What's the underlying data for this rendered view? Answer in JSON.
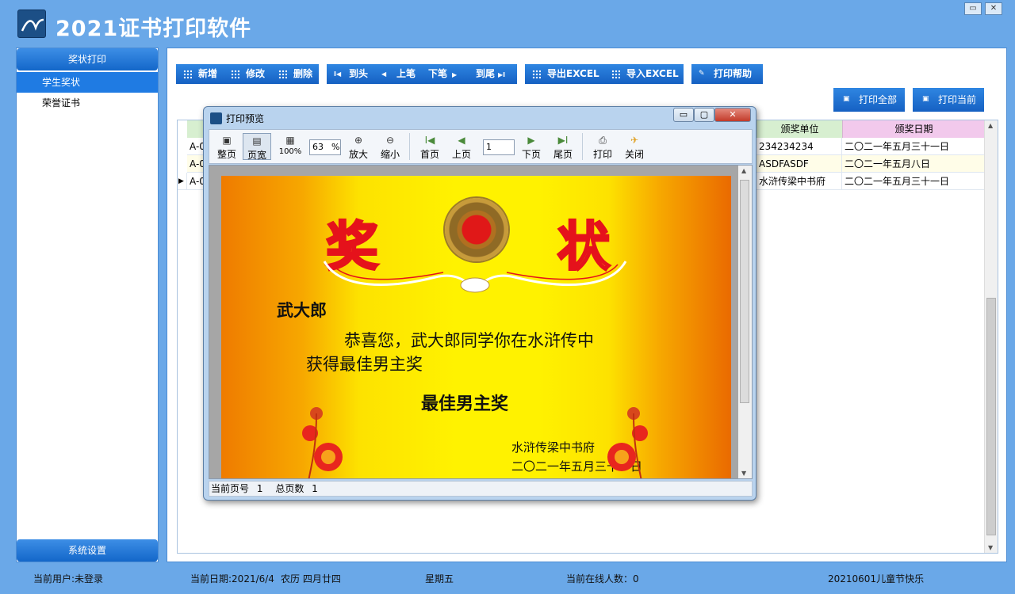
{
  "window": {
    "title": "2021证书打印软件",
    "minimize": "▭",
    "close": "✕"
  },
  "sidebar": {
    "header": "奖状打印",
    "items": [
      {
        "label": "学生奖状",
        "active": true
      },
      {
        "label": "荣誉证书",
        "active": false
      }
    ],
    "footer": "系统设置"
  },
  "toolbar": {
    "add": "新增",
    "edit": "修改",
    "delete": "删除",
    "first": "到头",
    "prev": "上笔",
    "next": "下笔",
    "last": "到尾",
    "export": "导出EXCEL",
    "import": "导入EXCEL",
    "help": "打印帮助",
    "print_all": "打印全部",
    "print_current": "打印当前"
  },
  "grid": {
    "columns": [
      "颁奖单位",
      "颁奖日期"
    ],
    "rows": [
      {
        "id": "A-0",
        "unit": "234234234",
        "date": "二〇二一年五月三十一日"
      },
      {
        "id": "A-0",
        "unit": "ASDFASDF",
        "date": "二〇二一年五月八日"
      },
      {
        "id": "A-0",
        "unit": "水浒传梁中书府",
        "date": "二〇二一年五月三十一日"
      }
    ]
  },
  "preview": {
    "title": "打印预览",
    "tools": {
      "whole_page": "整页",
      "page_width": "页宽",
      "percent100": "100%",
      "zoom_value": "63",
      "zoom_unit": "%",
      "zoom_in": "放大",
      "zoom_out": "缩小",
      "first_page": "首页",
      "prev_page": "上页",
      "page_value": "1",
      "next_page": "下页",
      "last_page": "尾页",
      "print": "打印",
      "close": "关闭"
    },
    "status": {
      "current_label": "当前页号",
      "current_value": "1",
      "total_label": "总页数",
      "total_value": "1"
    },
    "certificate": {
      "title_left": "奖",
      "title_right": "状",
      "name": "武大郎",
      "line1": "恭喜您，武大郎同学你在水浒传中",
      "line2": "获得最佳男主奖",
      "award": "最佳男主奖",
      "issuer": "水浒传梁中书府",
      "date": "二〇二一年五月三十一日"
    }
  },
  "statusbar": {
    "user": "当前用户:未登录",
    "date": "当前日期:2021/6/4",
    "lunar": "农历 四月廿四",
    "weekday": "星期五",
    "online": "当前在线人数：0",
    "note": "20210601儿童节快乐"
  },
  "colors": {
    "accent": "#1f7be3",
    "background": "#6aa8e8",
    "cert_red": "#e5121b",
    "cert_yellow": "#fff200"
  }
}
